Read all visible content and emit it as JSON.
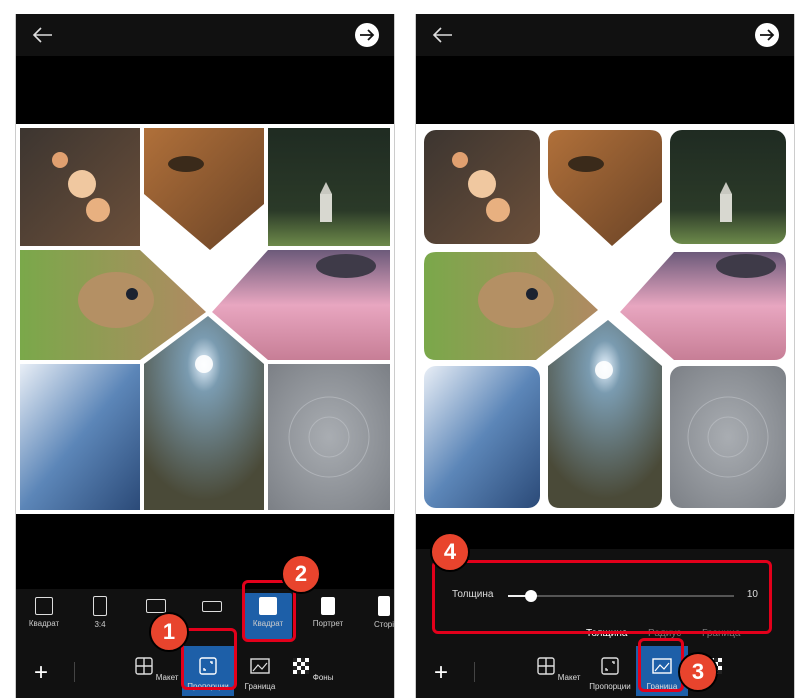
{
  "left_screen": {
    "ratio_options": [
      {
        "label": "Квадрат"
      },
      {
        "label": "3:4"
      },
      {
        "label": ""
      },
      {
        "label": ""
      },
      {
        "label": "Квадрат",
        "selected": true
      },
      {
        "label": "Портрет"
      },
      {
        "label": "Сторі"
      }
    ],
    "tabs": [
      {
        "label": "Макет"
      },
      {
        "label": "Пропорции",
        "selected": true
      },
      {
        "label": "Граница"
      },
      {
        "label": "Фоны"
      }
    ]
  },
  "right_screen": {
    "slider": {
      "label": "Толщина",
      "value": "10",
      "fraction": 0.1
    },
    "sub_tabs": [
      {
        "label": "Толщина",
        "selected": true
      },
      {
        "label": "Радиус"
      },
      {
        "label": "Граница"
      }
    ],
    "tabs": [
      {
        "label": "Макет"
      },
      {
        "label": "Пропорции"
      },
      {
        "label": "Граница",
        "selected": true
      },
      {
        "label": ""
      }
    ]
  },
  "callouts": [
    "1",
    "2",
    "3",
    "4"
  ],
  "colors": {
    "accent": "#1d5fa8",
    "callout": "#e8442d",
    "highlight": "#e3001b"
  }
}
